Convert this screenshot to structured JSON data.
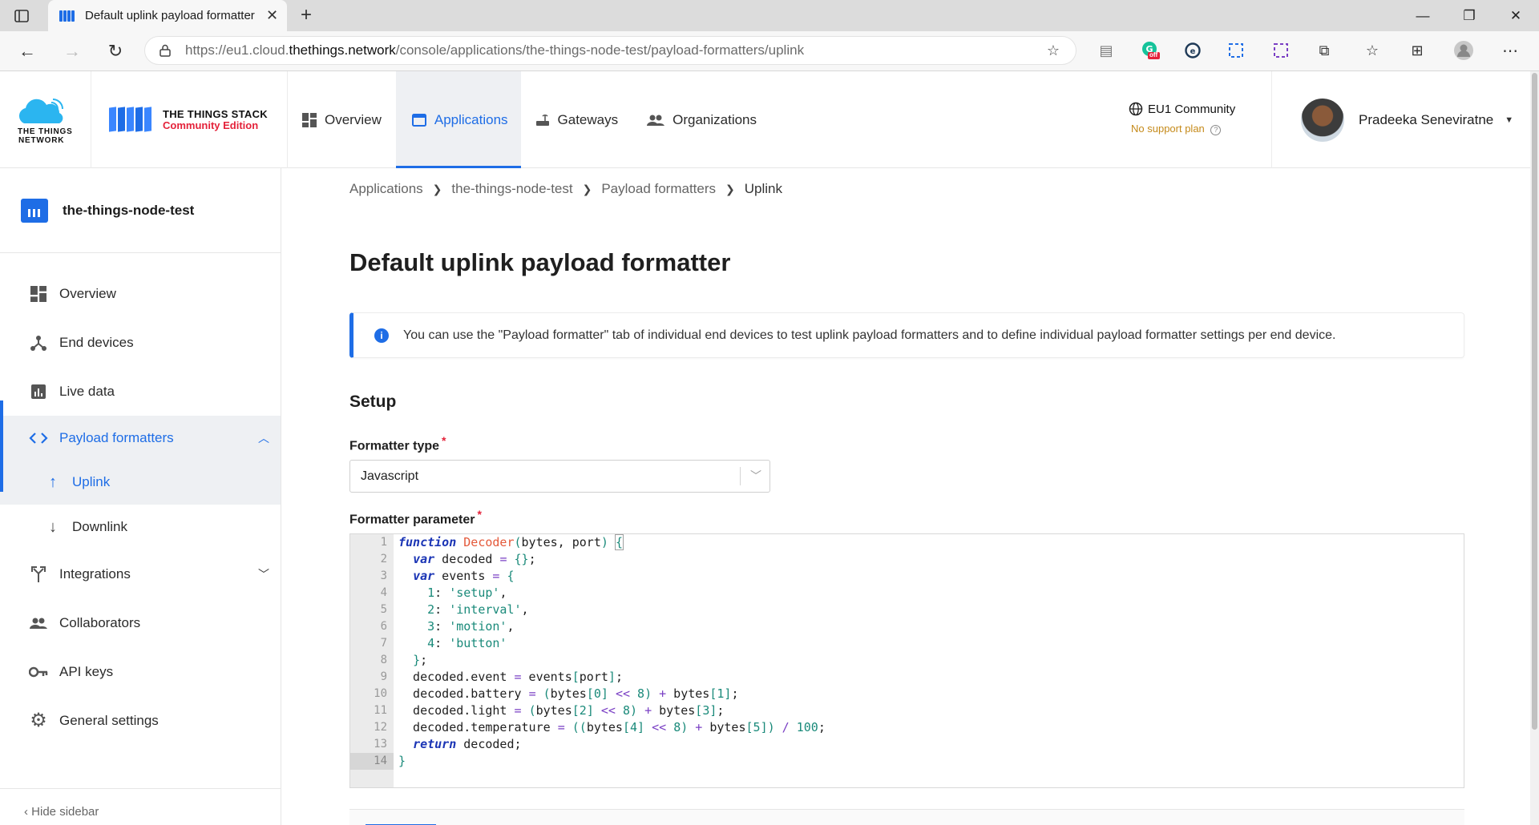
{
  "browser": {
    "tab_title": "Default uplink payload formatter",
    "url_base": "https://eu1.cloud.",
    "url_host": "thethings.network",
    "url_path": "/console/applications/the-things-node-test/payload-formatters/uplink",
    "extension_badge": "off"
  },
  "header": {
    "ttn_logo_line1": "THE THINGS",
    "ttn_logo_line2": "NETWORK",
    "stack_logo_line1": "THE THINGS STACK",
    "stack_logo_line2": "Community Edition",
    "nav": [
      {
        "label": "Overview",
        "icon": "grid-icon",
        "active": false
      },
      {
        "label": "Applications",
        "icon": "window-icon",
        "active": true
      },
      {
        "label": "Gateways",
        "icon": "router-icon",
        "active": false
      },
      {
        "label": "Organizations",
        "icon": "people-icon",
        "active": false
      }
    ],
    "cluster_name": "EU1 Community",
    "support_plan": "No support plan",
    "user_name": "Pradeeka Seneviratne"
  },
  "sidebar": {
    "app_name": "the-things-node-test",
    "items": [
      {
        "label": "Overview",
        "icon": "grid-icon"
      },
      {
        "label": "End devices",
        "icon": "devices-icon"
      },
      {
        "label": "Live data",
        "icon": "chart-icon"
      },
      {
        "label": "Payload formatters",
        "icon": "code-icon"
      },
      {
        "label": "Uplink",
        "icon": "arrow-up-icon"
      },
      {
        "label": "Downlink",
        "icon": "arrow-down-icon"
      },
      {
        "label": "Integrations",
        "icon": "merge-icon"
      },
      {
        "label": "Collaborators",
        "icon": "people-icon"
      },
      {
        "label": "API keys",
        "icon": "key-icon"
      },
      {
        "label": "General settings",
        "icon": "gear-icon"
      }
    ],
    "hide_sidebar": "Hide sidebar"
  },
  "main": {
    "breadcrumb": [
      "Applications",
      "the-things-node-test",
      "Payload formatters",
      "Uplink"
    ],
    "title": "Default uplink payload formatter",
    "notice": "You can use the \"Payload formatter\" tab of individual end devices to test uplink payload formatters and to define individual payload formatter settings per end device.",
    "setup_heading": "Setup",
    "formatter_type_label": "Formatter type",
    "formatter_type_value": "Javascript",
    "formatter_parameter_label": "Formatter parameter",
    "line_numbers": [
      "1",
      "2",
      "3",
      "4",
      "5",
      "6",
      "7",
      "8",
      "9",
      "10",
      "11",
      "12",
      "13",
      "14"
    ]
  },
  "colors": {
    "accent": "#1e6de6",
    "required": "#e4223a",
    "support_plan": "#c58a1a"
  }
}
